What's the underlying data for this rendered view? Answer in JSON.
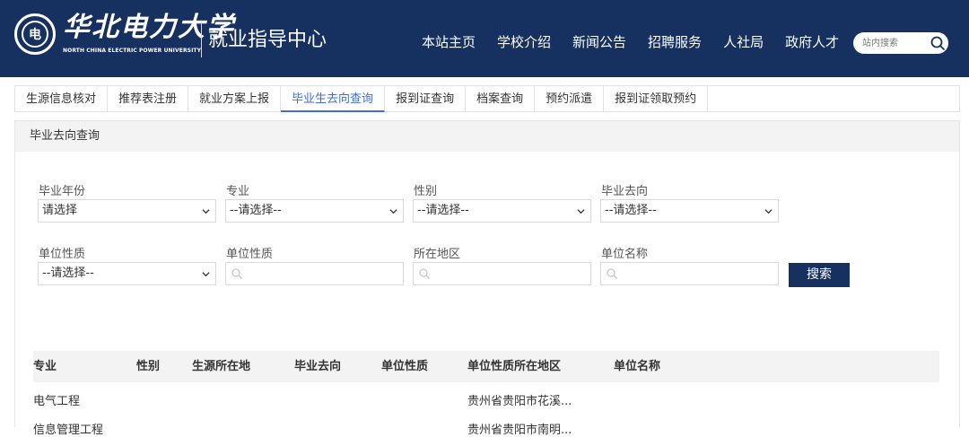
{
  "header": {
    "logo_seal_text": "电",
    "university_name": "华北电力大学",
    "university_name_en": "NORTH CHINA ELECTRIC POWER UNIVERSITY",
    "center_name": "就业指导中心",
    "nav": [
      "本站主页",
      "学校介绍",
      "新闻公告",
      "招聘服务",
      "人社局",
      "政府人才"
    ],
    "search_placeholder": "站内搜索"
  },
  "tabs": {
    "items": [
      "生源信息核对",
      "推荐表注册",
      "就业方案上报",
      "毕业生去向查询",
      "报到证查询",
      "档案查询",
      "预约派遣",
      "报到证领取预约"
    ],
    "active_index": 3
  },
  "panel": {
    "title": "毕业去向查询"
  },
  "filters": {
    "year": {
      "label": "毕业年份",
      "value": "请选择"
    },
    "major": {
      "label": "专业",
      "value": "--请选择--"
    },
    "gender": {
      "label": "性别",
      "value": "--请选择--"
    },
    "destination": {
      "label": "毕业去向",
      "value": "--请选择--"
    },
    "unit_nature_select": {
      "label": "单位性质",
      "value": "--请选择--"
    },
    "unit_nature_input": {
      "label": "单位性质"
    },
    "region": {
      "label": "所在地区"
    },
    "unit_name": {
      "label": "单位名称"
    },
    "search_button": "搜索"
  },
  "table": {
    "columns": [
      "专业",
      "性别",
      "生源所在地",
      "毕业去向",
      "单位性质",
      "单位性质所在地区",
      "单位名称"
    ],
    "rows": [
      {
        "major": "电气工程",
        "region": "贵州省贵阳市花溪..."
      },
      {
        "major": "信息管理工程",
        "region": "贵州省贵阳市南明..."
      }
    ]
  },
  "colors": {
    "header_bg": "#16305f",
    "active_tab": "#3f6fd6",
    "button_bg": "#16305f"
  }
}
